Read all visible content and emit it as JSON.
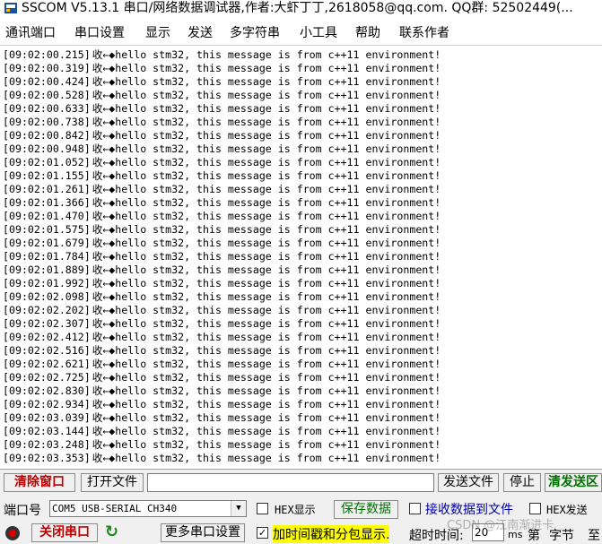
{
  "window": {
    "title": "SSCOM V5.13.1 串口/网络数据调试器,作者:大虾丁丁,2618058@qq.com. QQ群: 52502449(..."
  },
  "menu": [
    "通讯端口",
    "串口设置",
    "显示",
    "发送",
    "多字符串",
    "小工具",
    "帮助",
    "联系作者"
  ],
  "log": {
    "message": "收←◆hello stm32, this message is from c++11 environment!",
    "timestamps": [
      "[09:02:00.215]",
      "[09:02:00.319]",
      "[09:02:00.424]",
      "[09:02:00.528]",
      "[09:02:00.633]",
      "[09:02:00.738]",
      "[09:02:00.842]",
      "[09:02:00.948]",
      "[09:02:01.052]",
      "[09:02:01.155]",
      "[09:02:01.261]",
      "[09:02:01.366]",
      "[09:02:01.470]",
      "[09:02:01.575]",
      "[09:02:01.679]",
      "[09:02:01.784]",
      "[09:02:01.889]",
      "[09:02:01.992]",
      "[09:02:02.098]",
      "[09:02:02.202]",
      "[09:02:02.307]",
      "[09:02:02.412]",
      "[09:02:02.516]",
      "[09:02:02.621]",
      "[09:02:02.725]",
      "[09:02:02.830]",
      "[09:02:02.934]",
      "[09:02:03.039]",
      "[09:02:03.144]",
      "[09:02:03.248]",
      "[09:02:03.353]"
    ]
  },
  "toolbar": {
    "clear_window": "清除窗口",
    "open_file": "打开文件",
    "send_file": "发送文件",
    "stop": "停止",
    "clear_send": "清发送区"
  },
  "port": {
    "label": "端口号",
    "value": "COM5 USB-SERIAL CH340",
    "close_port": "关闭串口",
    "more_settings": "更多串口设置"
  },
  "options": {
    "hex_display": "HEX显示",
    "save_data": "保存数据",
    "recv_to_file": "接收数据到文件",
    "hex_send": "HEX发送",
    "timestamp_split": "加时间戳和分包显示.",
    "timeout_label": "超时时间:",
    "timeout_value": "20",
    "timeout_unit": "ms",
    "nth_label": "第",
    "byte_label": "字节",
    "to_label": "至",
    "watermark": "CSDN @江南渐进卡"
  }
}
